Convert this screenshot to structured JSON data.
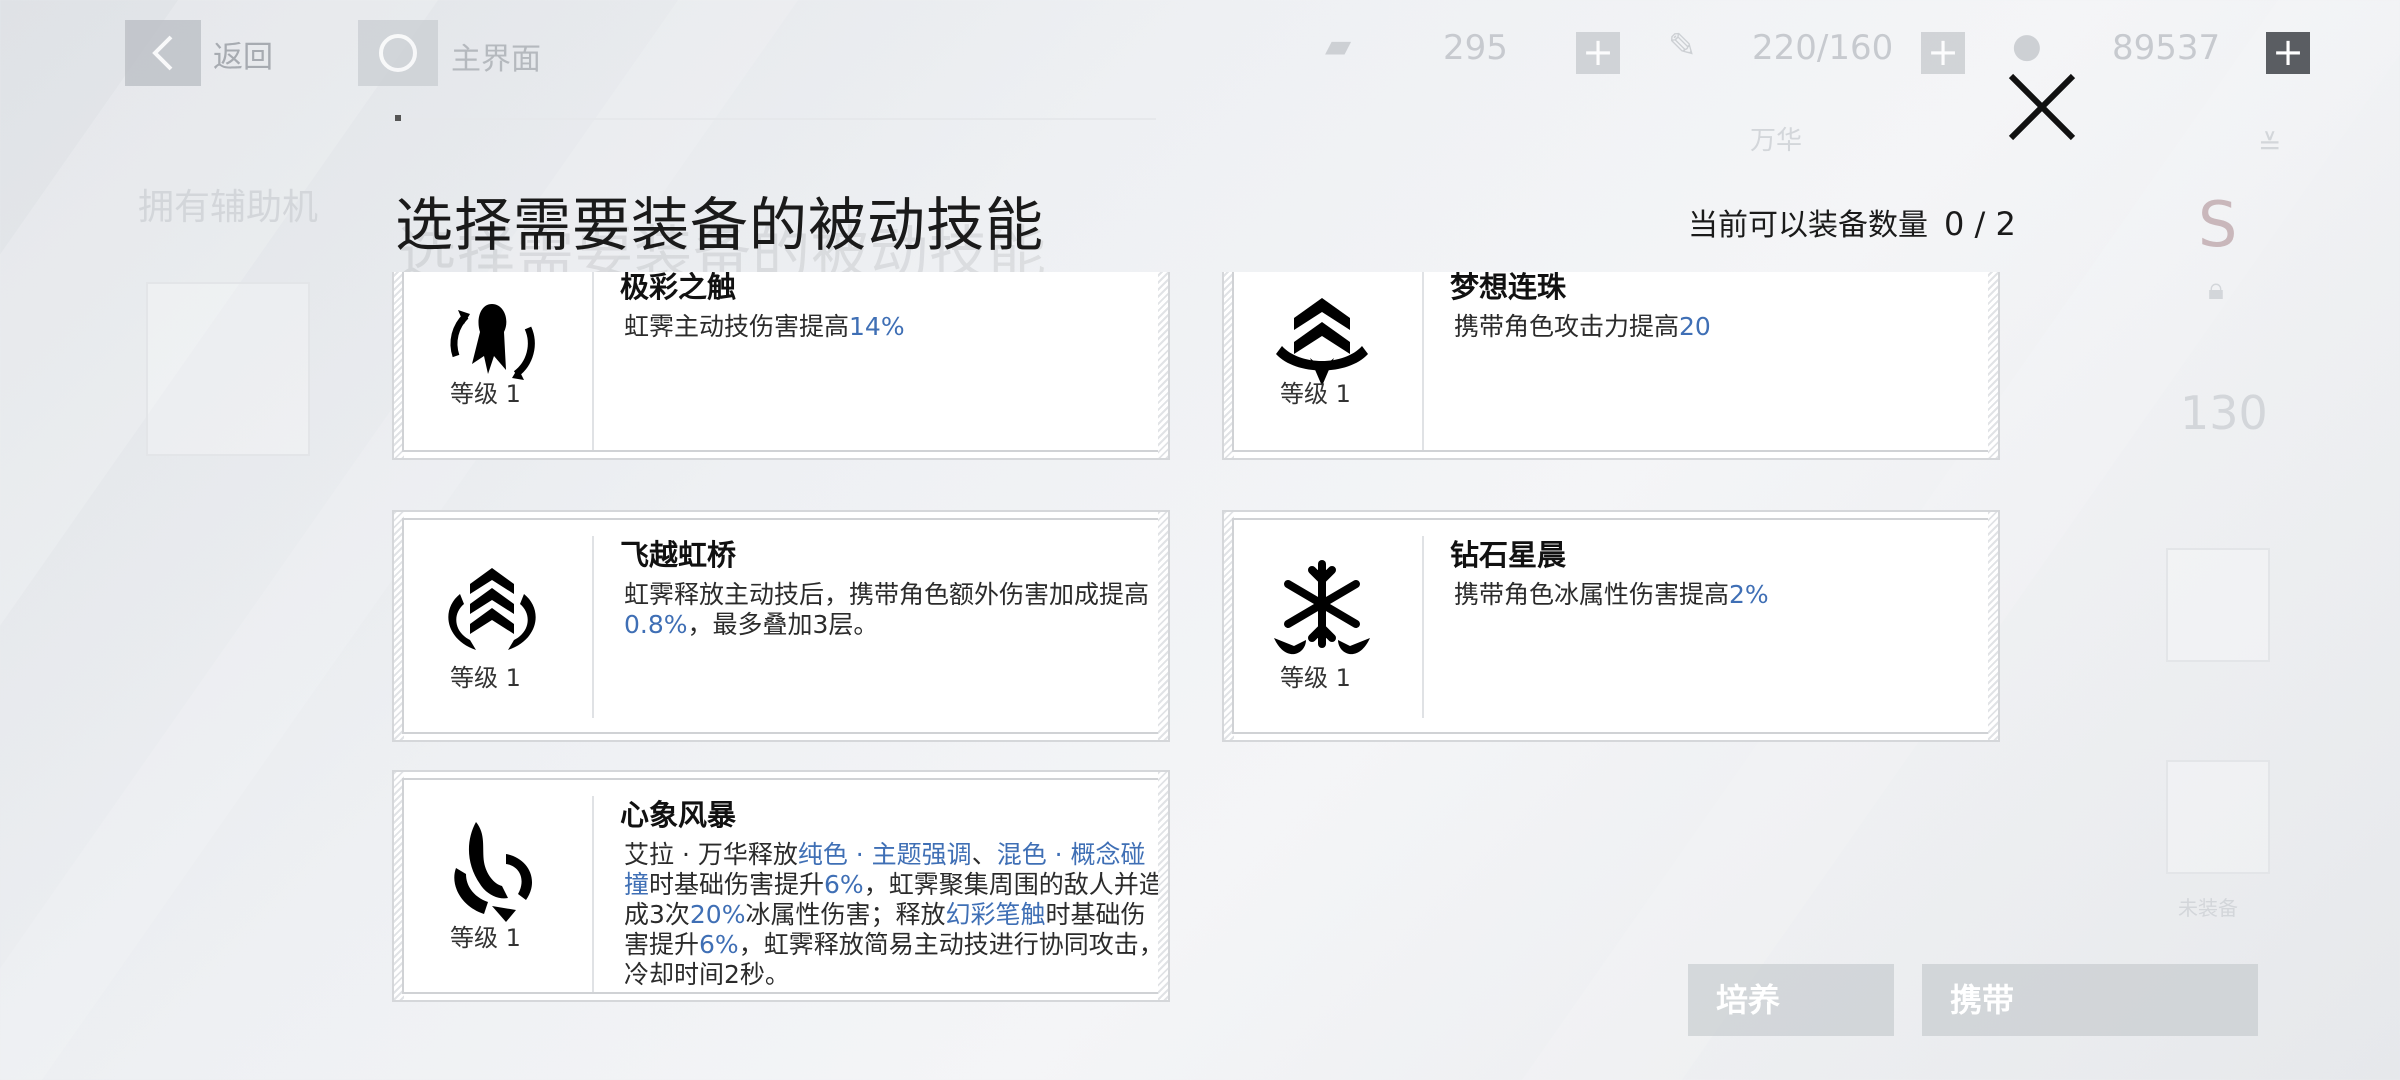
{
  "topbar": {
    "back_label": "返回",
    "home_label": "主界面",
    "resources": [
      {
        "icon": "stamina-icon",
        "value": "295"
      },
      {
        "icon": "tool-icon",
        "value": "220/160"
      },
      {
        "icon": "coin-icon",
        "value": "89537"
      }
    ]
  },
  "background": {
    "left_heading": "拥有辅助机",
    "right_label": "万华",
    "grade": "S",
    "level_value": "130",
    "unequipped": "未装备",
    "train_button": "培养",
    "carry_button": "携带"
  },
  "modal": {
    "title": "选择需要装备的被动技能",
    "equip_count_label": "当前可以装备数量",
    "equip_count_value": "0 / 2",
    "skills": [
      {
        "name": "极彩之触",
        "icon": "squid-arrows-icon",
        "level": "等级 1",
        "desc": [
          [
            "虹霁主动技伤害提高",
            false
          ],
          [
            "14%",
            true
          ]
        ]
      },
      {
        "name": "梦想连珠",
        "icon": "chevron-ribbon-icon",
        "level": "等级 1",
        "desc": [
          [
            "携带角色攻击力提高",
            false
          ],
          [
            "20",
            true
          ]
        ]
      },
      {
        "name": "飞越虹桥",
        "icon": "rank-chevrons-icon",
        "level": "等级 1",
        "desc": [
          [
            "虹霁释放主动技后，携带角色额外伤害加成提高",
            false
          ],
          [
            "0.8%",
            true
          ],
          [
            "，最多叠加3层。",
            false
          ]
        ]
      },
      {
        "name": "钻石星晨",
        "icon": "snowflake-icon",
        "level": "等级 1",
        "desc": [
          [
            "携带角色冰属性伤害提高",
            false
          ],
          [
            "2%",
            true
          ]
        ]
      },
      {
        "name": "心象风暴",
        "icon": "orca-splash-icon",
        "level": "等级 1",
        "desc": [
          [
            "艾拉 · 万华释放",
            false
          ],
          [
            "纯色 · 主题强调",
            true
          ],
          [
            "、",
            false
          ],
          [
            "混色 · 概念碰撞",
            true
          ],
          [
            "时基础伤害提升",
            false
          ],
          [
            "6%",
            true
          ],
          [
            "，虹霁聚集周围的敌人并造成3次",
            false
          ],
          [
            "20%",
            true
          ],
          [
            "冰属性伤害；释放",
            false
          ],
          [
            "幻彩笔触",
            true
          ],
          [
            "时基础伤害提升",
            false
          ],
          [
            "6%",
            true
          ],
          [
            "，虹霁释放简易主动技进行协同攻击，冷却时间2秒。",
            false
          ]
        ]
      }
    ]
  },
  "colors": {
    "highlight": "#3f6fb5",
    "text": "#111111",
    "card_border": "#d5d7da"
  }
}
